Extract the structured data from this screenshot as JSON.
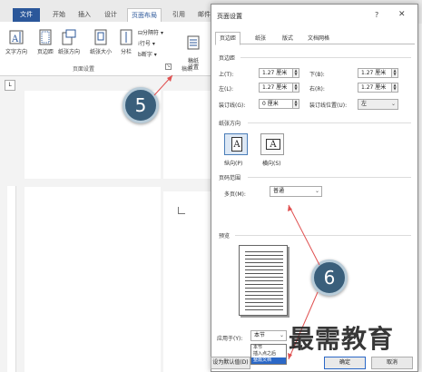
{
  "ribbon": {
    "tabs": [
      "文件",
      "开始",
      "插入",
      "设计",
      "页面布局",
      "引用",
      "邮件"
    ],
    "buttons": [
      "文字方向",
      "页边距",
      "纸张方向",
      "纸张大小",
      "分栏"
    ],
    "small_commands": [
      "分隔符",
      "行号",
      "断字"
    ],
    "draft_paper": "稿纸\n设置",
    "group_page_setup": "页面设置",
    "group_draft": "稿纸",
    "ruler_corner": "L"
  },
  "callouts": {
    "first": "5",
    "second": "6"
  },
  "dialog": {
    "title": "页面设置",
    "help": "?",
    "close": "✕",
    "tabs": [
      "页边距",
      "纸张",
      "版式",
      "文档网格"
    ],
    "margins_section": "页边距",
    "top_label": "上(T):",
    "top_value": "1.27 厘米",
    "bottom_label": "下(B):",
    "bottom_value": "1.27 厘米",
    "left_label": "左(L):",
    "left_value": "1.27 厘米",
    "right_label": "右(R):",
    "right_value": "1.27 厘米",
    "gutter_label": "装订线(G):",
    "gutter_value": "0 厘米",
    "gutter_pos_label": "装订线位置(U):",
    "gutter_pos_value": "左",
    "orientation_section": "纸张方向",
    "portrait": "纵向(P)",
    "landscape": "横向(S)",
    "pages_section": "页码范围",
    "multiple_pages_label": "多页(M):",
    "multiple_pages_value": "普通",
    "preview_section": "预览",
    "apply_to_label": "应用于(Y):",
    "apply_to_value": "本节",
    "apply_to_options": [
      "本节",
      "插入点之后",
      "整篇文档"
    ],
    "apply_to_selected": "整篇文档",
    "set_default": "设为默认值(D)",
    "ok": "确定",
    "cancel": "取消"
  },
  "watermark": "最需教育"
}
